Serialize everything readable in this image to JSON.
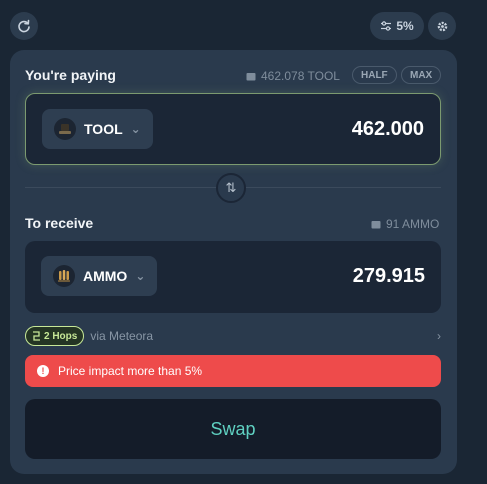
{
  "header": {
    "slippage_label": "5%"
  },
  "pay": {
    "title": "You're paying",
    "balance": "462.078 TOOL",
    "half_label": "HALF",
    "max_label": "MAX",
    "token": "TOOL",
    "amount": "462.000"
  },
  "receive": {
    "title": "To receive",
    "balance": "91 AMMO",
    "token": "AMMO",
    "amount": "279.915"
  },
  "route": {
    "hops_label": "2 Hops",
    "via": "via Meteora"
  },
  "warning": {
    "text": "Price impact more than 5%"
  },
  "swap_label": "Swap",
  "icons": {
    "refresh": "refresh-icon",
    "slippage": "sliders-icon",
    "settings": "gear-icon",
    "wallet": "wallet-icon",
    "swap_direction": "arrows-updown-icon",
    "warning": "alert-circle-icon"
  },
  "colors": {
    "background": "#1a2634",
    "panel": "#2a3a4d",
    "accent_green": "#c7e897",
    "warning_red": "#ee4b4b",
    "swap_text": "#5fd0c1"
  }
}
